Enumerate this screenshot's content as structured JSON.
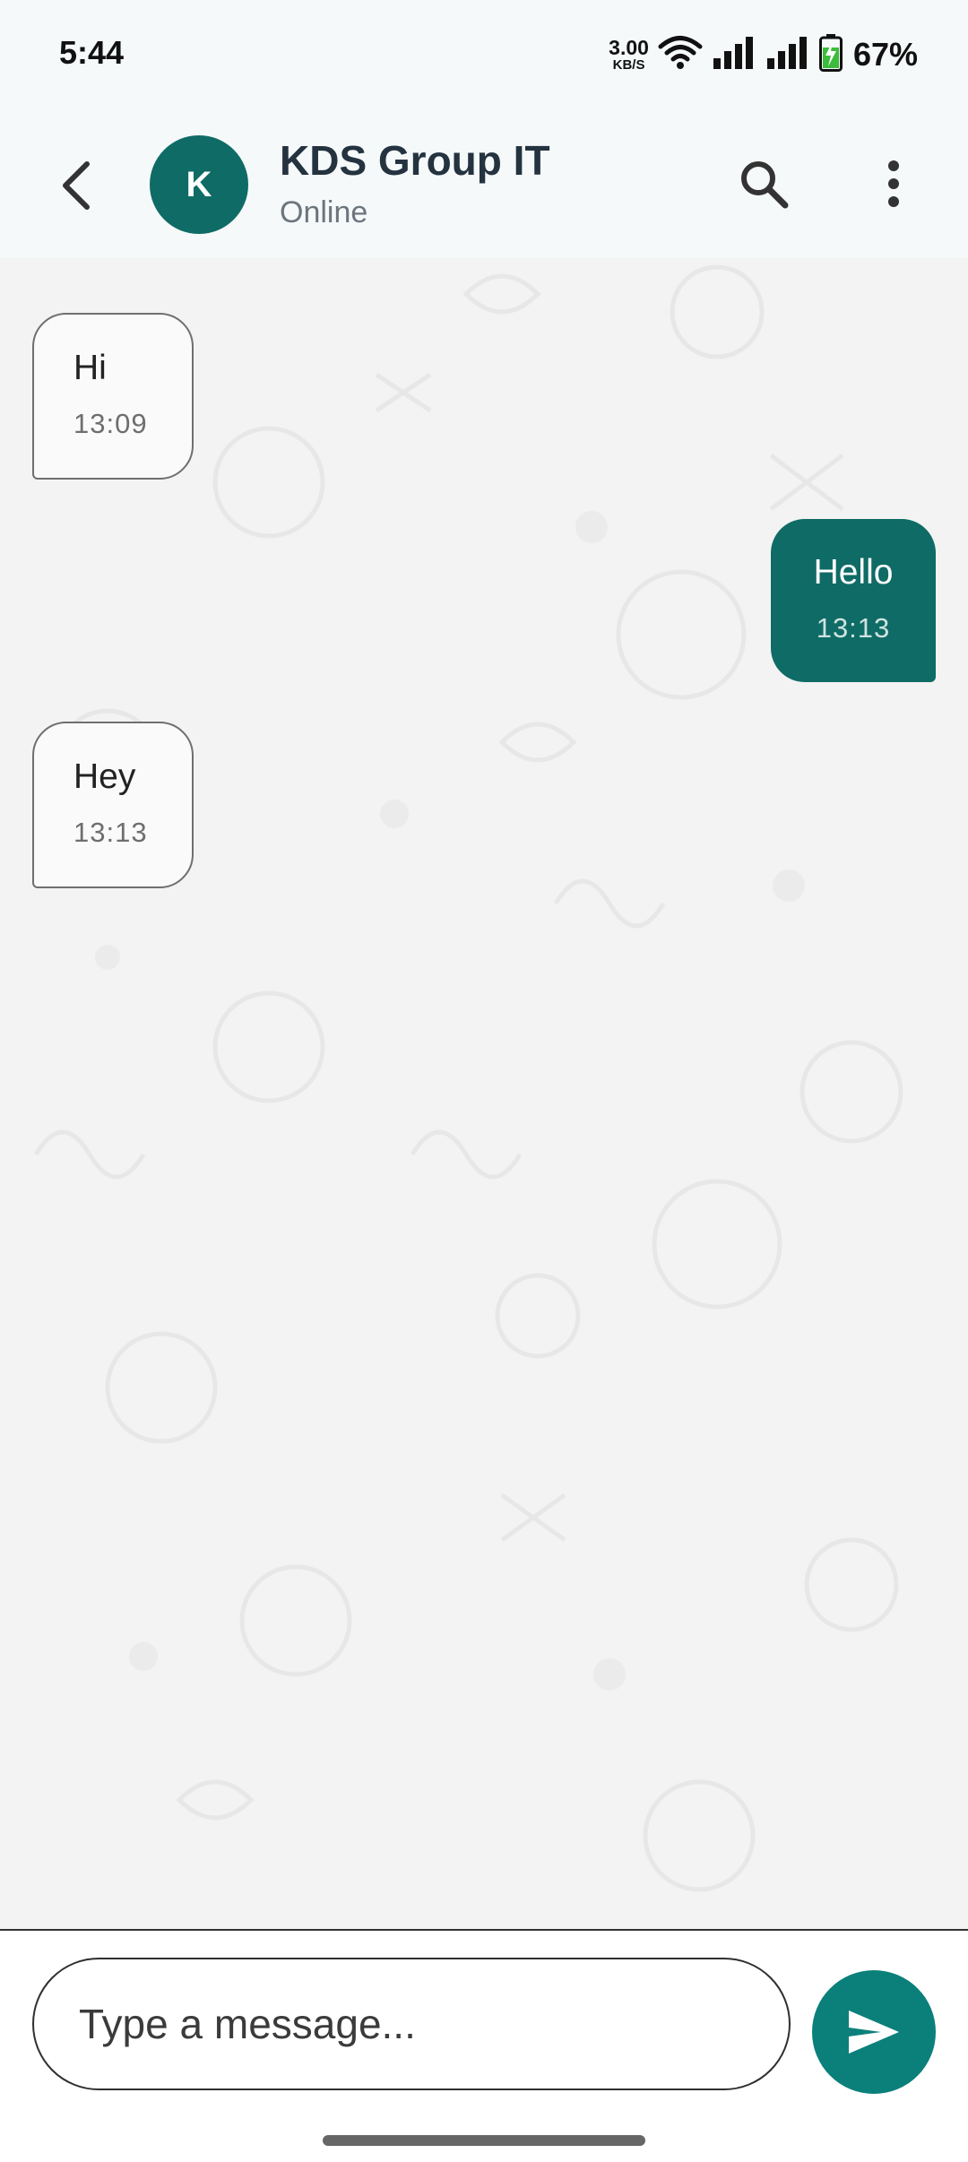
{
  "status_bar": {
    "time": "5:44",
    "net_speed_value": "3.00",
    "net_speed_unit": "KB/S",
    "battery_percent": "67%"
  },
  "header": {
    "avatar_letter": "K",
    "title": "KDS Group IT",
    "subtitle": "Online"
  },
  "messages": [
    {
      "direction": "incoming",
      "text": "Hi",
      "time": "13:09"
    },
    {
      "direction": "outgoing",
      "text": "Hello",
      "time": "13:13"
    },
    {
      "direction": "incoming",
      "text": "Hey",
      "time": "13:13"
    }
  ],
  "composer": {
    "placeholder": "Type a message...",
    "value": ""
  },
  "icons": {
    "back": "chevron-left-icon",
    "search": "search-icon",
    "more": "more-vertical-icon",
    "send": "send-icon",
    "wifi": "wifi-icon",
    "signal": "signal-icon",
    "battery": "battery-charging-icon"
  },
  "colors": {
    "accent": "#0f6b65",
    "send_button": "#0b807a",
    "header_bg": "#f5f9fa",
    "chat_bg": "#f3f3f3",
    "incoming_bubble": "#fafafa",
    "outgoing_bubble": "#0f6b65"
  }
}
